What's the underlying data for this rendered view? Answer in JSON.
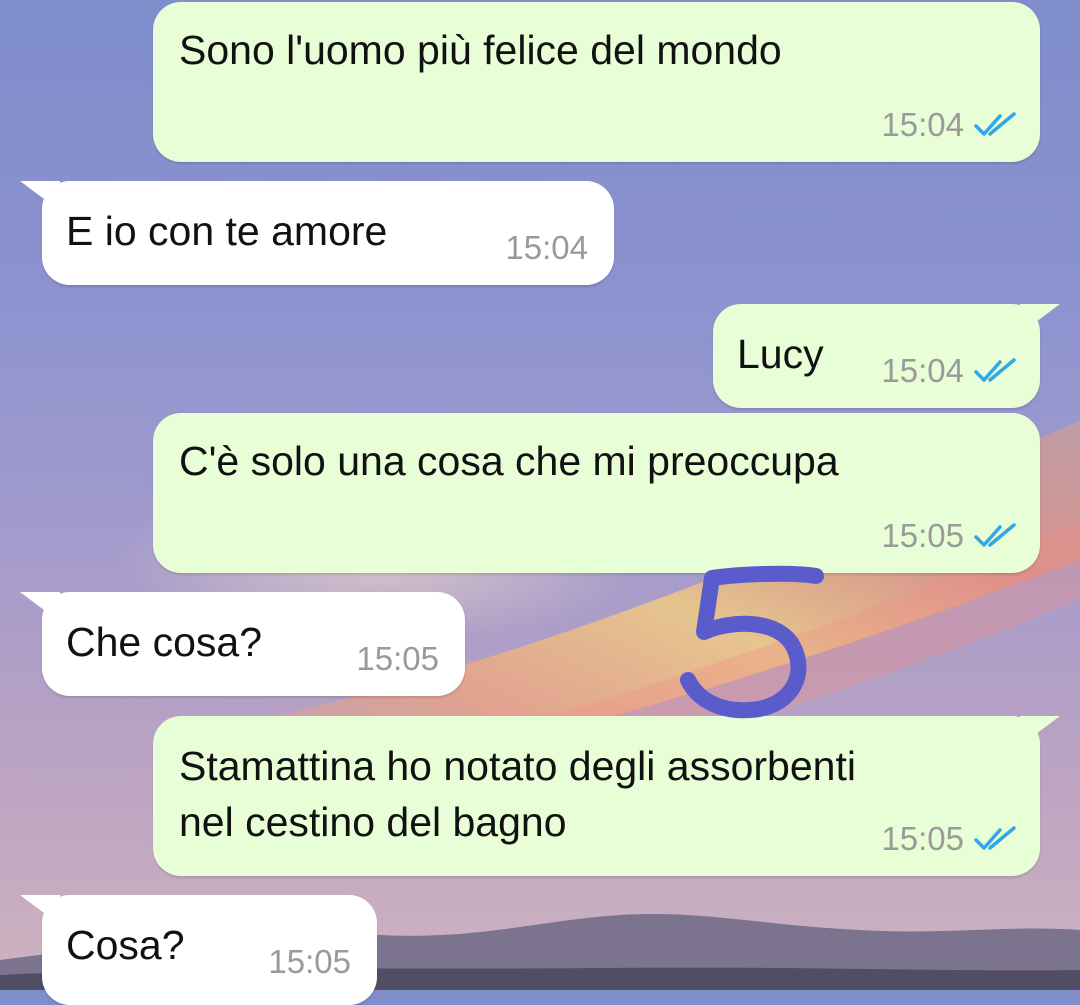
{
  "messages": [
    {
      "direction": "outgoing",
      "text": "Sono l'uomo più felice del mondo",
      "time": "15:04",
      "status": "read"
    },
    {
      "direction": "incoming",
      "text": "E io con te amore",
      "time": "15:04"
    },
    {
      "direction": "outgoing",
      "text": "Lucy",
      "time": "15:04",
      "status": "read"
    },
    {
      "direction": "outgoing",
      "text": "C'è solo una cosa che mi preoccupa",
      "time": "15:05",
      "status": "read"
    },
    {
      "direction": "incoming",
      "text": "Che cosa?",
      "time": "15:05"
    },
    {
      "direction": "outgoing",
      "text": "Stamattina ho notato degli assorbenti\nnel cestino del bagno",
      "time": "15:05",
      "status": "read"
    },
    {
      "direction": "incoming",
      "text": "Cosa?",
      "time": "15:05"
    }
  ],
  "annotation": {
    "handwritten_mark": "5",
    "color": "#5a5ccc"
  },
  "colors": {
    "outgoing_bubble": "#e7fed7",
    "incoming_bubble": "#ffffff",
    "read_tick": "#34a6e8",
    "time_text": "#9a9a9a"
  }
}
